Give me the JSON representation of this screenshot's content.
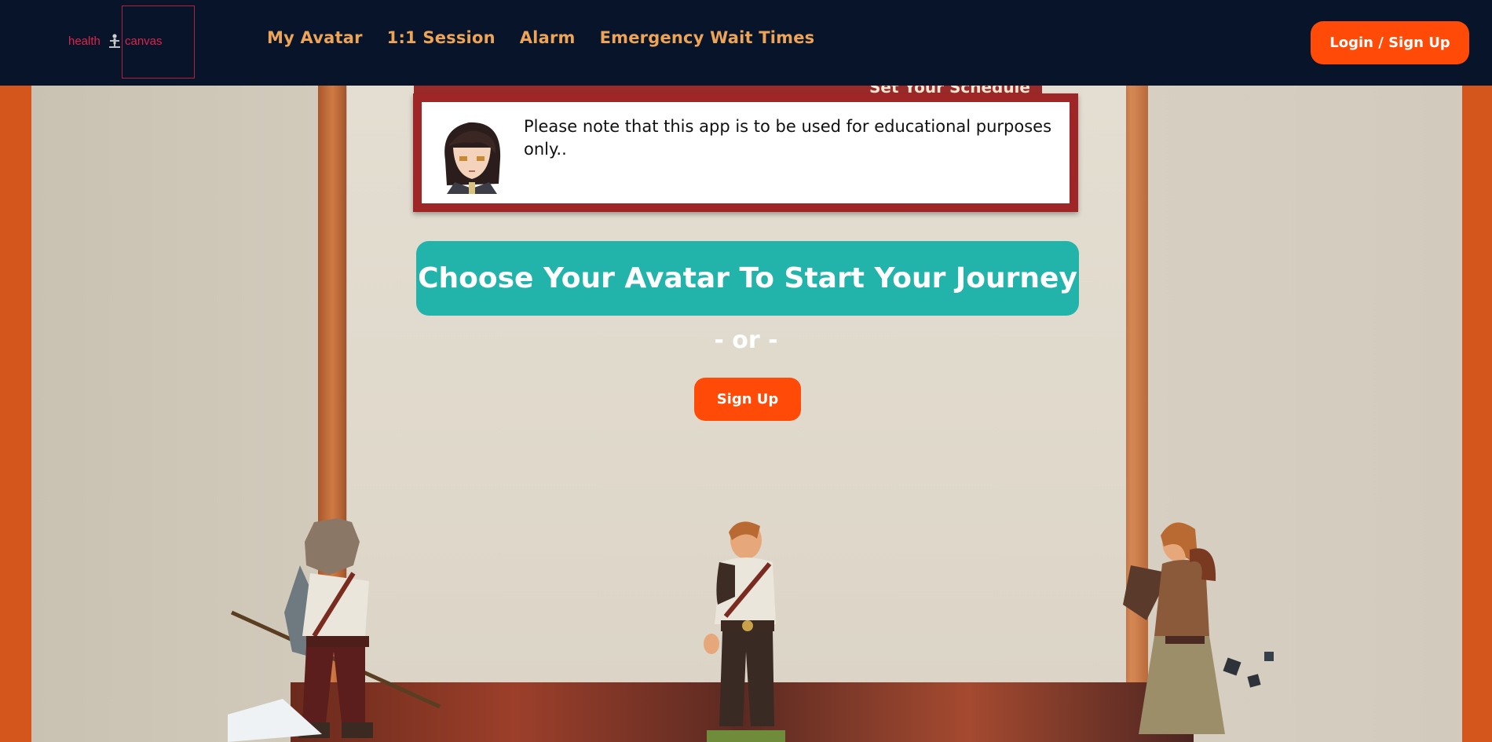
{
  "logo": {
    "left_text": "health",
    "right_text": "canvas"
  },
  "nav": {
    "links": [
      "My Avatar",
      "1:1 Session",
      "Alarm",
      "Emergency Wait Times"
    ],
    "login_label": "Login / Sign Up"
  },
  "banner": {
    "text": "Set Your Schedule Through Alarms"
  },
  "notice": {
    "text": "Please note that this app is to be used for educational purposes only.."
  },
  "cta": {
    "label": "Choose Your Avatar To Start Your Journey"
  },
  "or_text": "- or -",
  "signup_label": "Sign Up",
  "characters": [
    "werewolf-warrior-avatar",
    "swordsman-avatar",
    "ranger-avatar"
  ],
  "colors": {
    "nav_bg": "#07142a",
    "nav_link": "#eea456",
    "accent_orange": "#ff4a08",
    "teal": "#22b3aa",
    "notice_border": "#9e2626",
    "logo_red": "#e0224a",
    "frame_orange": "#d4561d"
  }
}
